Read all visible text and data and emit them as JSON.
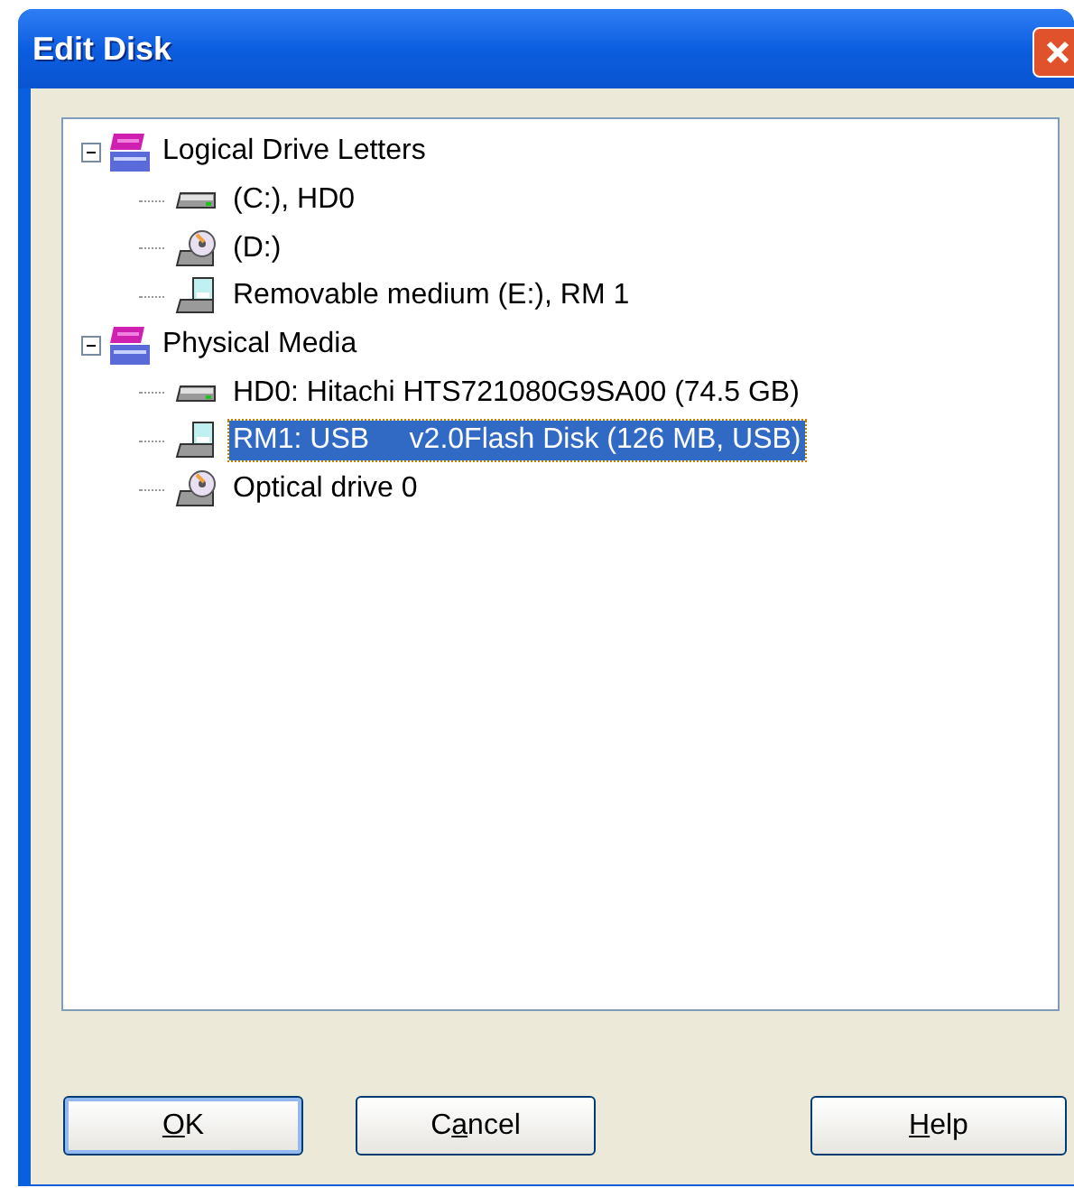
{
  "window": {
    "title": "Edit Disk"
  },
  "tree": [
    {
      "label": "Logical Drive Letters",
      "kind": "hex",
      "expanded": true,
      "selected": false,
      "children": [
        {
          "label": "(C:), HD0",
          "kind": "hdd",
          "selected": false
        },
        {
          "label": "(D:)",
          "kind": "optical",
          "selected": false
        },
        {
          "label": "Removable medium (E:), RM 1",
          "kind": "removable",
          "selected": false
        }
      ]
    },
    {
      "label": "Physical Media",
      "kind": "hex",
      "expanded": true,
      "selected": false,
      "children": [
        {
          "label": "HD0: Hitachi HTS721080G9SA00 (74.5 GB)",
          "kind": "hdd",
          "selected": false
        },
        {
          "label": "RM1: USB     v2.0Flash Disk (126 MB, USB)",
          "kind": "removable",
          "selected": true
        },
        {
          "label": "Optical drive 0",
          "kind": "optical",
          "selected": false
        }
      ]
    }
  ],
  "buttons": [
    {
      "access_key": "O",
      "after": "K",
      "default": true
    },
    {
      "before": "C",
      "access_key": "a",
      "after": "ncel",
      "default": false
    },
    {
      "access_key": "H",
      "after": "elp",
      "default": false
    }
  ]
}
